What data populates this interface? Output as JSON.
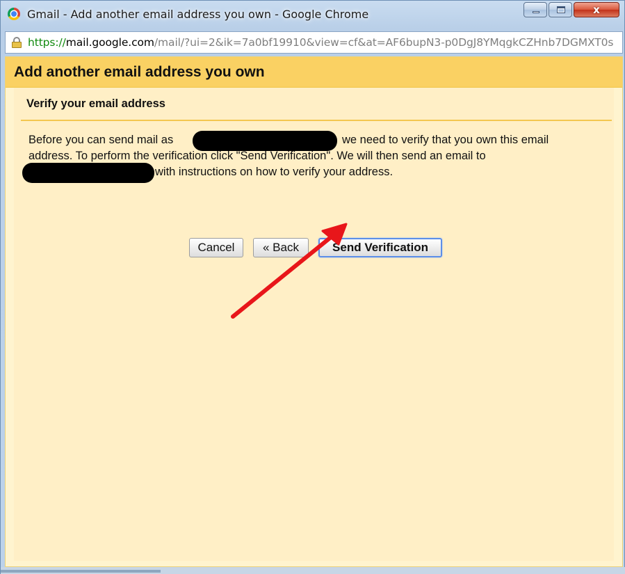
{
  "window": {
    "title": "Gmail - Add another email address you own - Google Chrome",
    "controls": {
      "minimize_icon": "minimize-icon",
      "maximize_icon": "maximize-icon",
      "close_icon": "close-icon",
      "close_glyph": "x"
    }
  },
  "address_bar": {
    "scheme": "https://",
    "host": "mail.google.com",
    "path": "/mail/?ui=2&ik=7a0bf19910&view=cf&at=AF6bupN3-p0DgJ8YMqgkCZHnb7DGMXT0s",
    "icon": "lock-icon"
  },
  "dialog": {
    "title": "Add another email address you own",
    "section_title": "Verify your email address",
    "text": {
      "line1_before": "Before you can send mail as",
      "line1_after": "we need to verify that you own this email",
      "line2": "address. To perform the verification click \"Send Verification\". We will then send an email to",
      "line3_after": "with instructions on how to verify your address."
    },
    "buttons": {
      "cancel": "Cancel",
      "back": "« Back",
      "send_verification": "Send Verification"
    }
  },
  "annotation": {
    "arrow_color": "#e8161a",
    "points_to": "Send Verification"
  },
  "colors": {
    "header_bg": "#fad163",
    "content_bg": "#fff4cf",
    "panel_bg": "#ffefc6",
    "focus_border": "#5c8ee8"
  }
}
